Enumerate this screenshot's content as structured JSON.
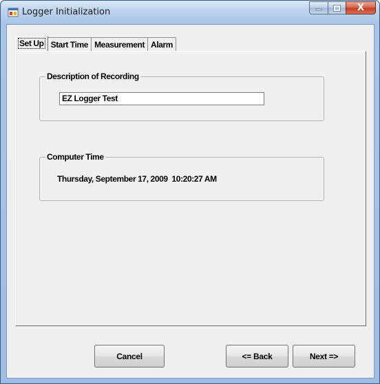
{
  "window": {
    "title": "Logger Initialization",
    "close_glyph": "X"
  },
  "tabs": [
    {
      "label": "Set Up",
      "selected": true
    },
    {
      "label": "Start Time",
      "selected": false
    },
    {
      "label": "Measurement",
      "selected": false
    },
    {
      "label": "Alarm",
      "selected": false
    }
  ],
  "setup": {
    "description_legend": "Description of Recording",
    "description_value": "EZ Logger Test",
    "computer_time_legend": "Computer Time",
    "computer_time_value": "Thursday, September 17, 2009  10:20:27 AM"
  },
  "buttons": {
    "cancel": "Cancel",
    "back": "<= Back",
    "next": "Next =>"
  },
  "icons": {
    "app": "app-window-icon",
    "minimize": "minimize-icon",
    "maximize": "maximize-icon",
    "close": "close-icon"
  }
}
